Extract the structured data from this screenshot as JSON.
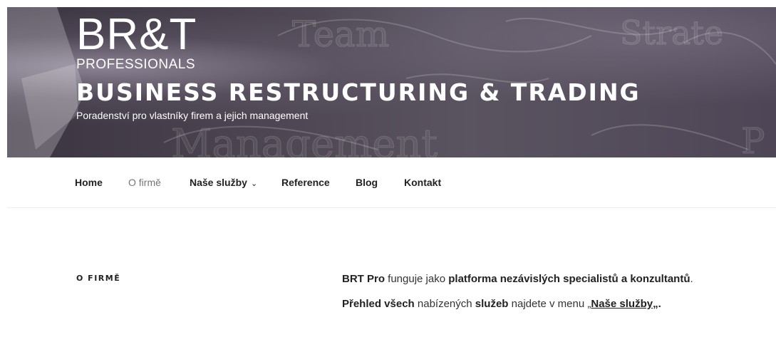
{
  "header": {
    "logo_main": "BR&T",
    "logo_sub": "PROFESSIONALS",
    "site_title": "BUSINESS RESTRUCTURING & TRADING",
    "tagline": "Poradenství pro vlastníky firem a jejich management",
    "bg_words": [
      "Team",
      "Strate",
      "Management",
      "P"
    ]
  },
  "nav": {
    "items": [
      {
        "label": "Home"
      },
      {
        "label": "O firmě"
      },
      {
        "label": "Naše služby"
      },
      {
        "label": "Reference"
      },
      {
        "label": "Blog"
      },
      {
        "label": "Kontakt"
      }
    ],
    "active_index": 1,
    "dropdown_icon": "chevron-down-icon"
  },
  "page": {
    "title": "O FIRMĚ",
    "p1": {
      "b1": "BRT Pro",
      "t1": " funguje jako ",
      "b2": "platforma nezávislých specialistů a konzultantů",
      "t2": "."
    },
    "p2": {
      "b1": "Přehled všech",
      "t1": " nabízených ",
      "b2": "služeb",
      "t2": " najdete v menu „",
      "link": "Naše služby",
      "t3": "„."
    }
  },
  "colors": {
    "header_bg": "#4b4450",
    "nav_active": "#767676",
    "text": "#222222"
  }
}
